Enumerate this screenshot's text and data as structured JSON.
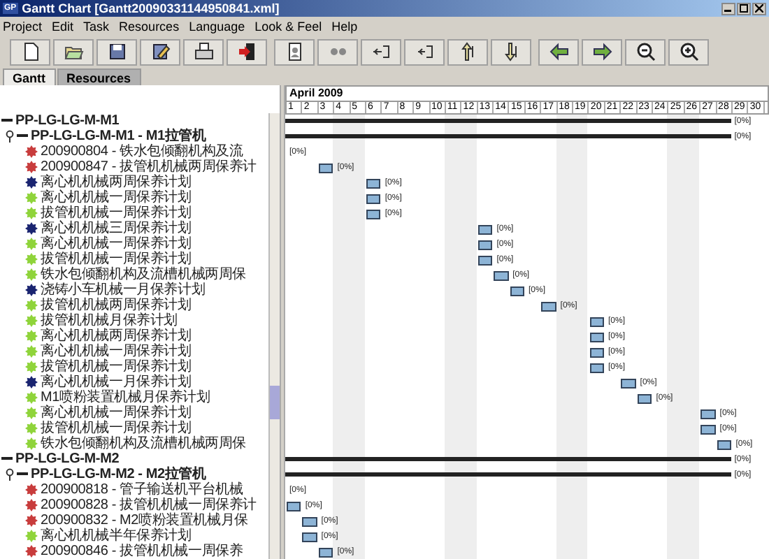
{
  "window": {
    "icon": "GP",
    "title": "Gantt Chart [Gantt20090331144950841.xml]"
  },
  "menu": [
    "Project",
    "Edit",
    "Task",
    "Resources",
    "Language",
    "Look & Feel",
    "Help"
  ],
  "tabs": [
    {
      "label": "Gantt",
      "selected": true
    },
    {
      "label": "Resources",
      "selected": false
    }
  ],
  "timeline": {
    "month": "April  2009",
    "days": [
      {
        "label": "1",
        "weekend": false
      },
      {
        "label": "2",
        "weekend": false
      },
      {
        "label": "3",
        "weekend": false
      },
      {
        "label": "4",
        "weekend": true
      },
      {
        "label": "5",
        "weekend": true
      },
      {
        "label": "6",
        "weekend": false
      },
      {
        "label": "7",
        "weekend": false
      },
      {
        "label": "8",
        "weekend": false
      },
      {
        "label": "9",
        "weekend": false
      },
      {
        "label": "10",
        "weekend": false
      },
      {
        "label": "11",
        "weekend": true
      },
      {
        "label": "12",
        "weekend": true
      },
      {
        "label": "13",
        "weekend": false
      },
      {
        "label": "14",
        "weekend": false
      },
      {
        "label": "15",
        "weekend": false
      },
      {
        "label": "16",
        "weekend": false
      },
      {
        "label": "17",
        "weekend": false
      },
      {
        "label": "18",
        "weekend": true
      },
      {
        "label": "19",
        "weekend": true
      },
      {
        "label": "20",
        "weekend": false
      },
      {
        "label": "21",
        "weekend": false
      },
      {
        "label": "22",
        "weekend": false
      },
      {
        "label": "23",
        "weekend": false
      },
      {
        "label": "24",
        "weekend": false
      },
      {
        "label": "25",
        "weekend": true
      },
      {
        "label": "26",
        "weekend": true
      },
      {
        "label": "27",
        "weekend": false
      },
      {
        "label": "28",
        "weekend": false
      },
      {
        "label": "29",
        "weekend": false
      },
      {
        "label": "30",
        "weekend": false
      }
    ]
  },
  "tasks": [
    {
      "name": "PP-LG-LG-M-M1",
      "bar": {
        "kind": "summary",
        "label": "[0%]"
      },
      "children": [
        {
          "name": "PP-LG-LG-M-M1 - M1拉管机",
          "expanded": true,
          "bar": {
            "kind": "summary",
            "label": "[0%]"
          },
          "children": [
            {
              "name": "200900804 - 铁水包倾翻机构及流",
              "color": "#c83c3c",
              "bar": {
                "kind": "milestone",
                "label": "[0%]"
              }
            },
            {
              "name": "200900847 - 拔管机机械两周保养计",
              "color": "#c83c3c",
              "bar": {
                "kind": "task",
                "label": "[0%]"
              }
            },
            {
              "name": "离心机机械两周保养计划",
              "color": "#1a2470",
              "bar": {
                "kind": "task",
                "label": "[0%]"
              }
            },
            {
              "name": "离心机机械一周保养计划",
              "color": "#8fd43a",
              "bar": {
                "kind": "task",
                "label": "[0%]"
              }
            },
            {
              "name": "拔管机机械一周保养计划",
              "color": "#8fd43a",
              "bar": {
                "kind": "task",
                "label": "[0%]"
              }
            },
            {
              "name": "离心机机械三周保养计划",
              "color": "#1a2470",
              "bar": {
                "kind": "task",
                "label": "[0%]"
              }
            },
            {
              "name": "离心机机械一周保养计划",
              "color": "#8fd43a",
              "bar": {
                "kind": "task",
                "label": "[0%]"
              }
            },
            {
              "name": "拔管机机械一周保养计划",
              "color": "#8fd43a",
              "bar": {
                "kind": "task",
                "label": "[0%]"
              }
            },
            {
              "name": "铁水包倾翻机构及流槽机械两周保",
              "color": "#8fd43a",
              "bar": {
                "kind": "task",
                "label": "[0%]"
              }
            },
            {
              "name": "浇铸小车机械一月保养计划",
              "color": "#1a2470",
              "bar": {
                "kind": "task",
                "label": "[0%]"
              }
            },
            {
              "name": "拔管机机械两周保养计划",
              "color": "#8fd43a",
              "bar": {
                "kind": "task",
                "label": "[0%]"
              }
            },
            {
              "name": "拔管机机械月保养计划",
              "color": "#8fd43a",
              "bar": {
                "kind": "task",
                "label": "[0%]"
              }
            },
            {
              "name": "离心机机械两周保养计划",
              "color": "#8fd43a",
              "bar": {
                "kind": "task",
                "label": "[0%]"
              }
            },
            {
              "name": "离心机机械一周保养计划",
              "color": "#8fd43a",
              "bar": {
                "kind": "task",
                "label": "[0%]"
              }
            },
            {
              "name": "拔管机机械一周保养计划",
              "color": "#8fd43a",
              "bar": {
                "kind": "task",
                "label": "[0%]"
              }
            },
            {
              "name": "离心机机械一月保养计划",
              "color": "#1a2470",
              "bar": {
                "kind": "task",
                "label": "[0%]"
              }
            },
            {
              "name": "M1喷粉装置机械月保养计划",
              "color": "#8fd43a",
              "bar": {
                "kind": "task",
                "label": "[0%]"
              }
            },
            {
              "name": "离心机机械一周保养计划",
              "color": "#8fd43a",
              "bar": {
                "kind": "task",
                "label": "[0%]"
              }
            },
            {
              "name": "拔管机机械一周保养计划",
              "color": "#8fd43a",
              "bar": {
                "kind": "task",
                "label": "[0%]"
              }
            },
            {
              "name": "铁水包倾翻机构及流槽机械两周保",
              "color": "#8fd43a",
              "bar": {
                "kind": "task",
                "label": "[0%]"
              }
            }
          ]
        }
      ]
    },
    {
      "name": "PP-LG-LG-M-M2",
      "bar": {
        "kind": "summary",
        "label": "[0%]"
      },
      "children": [
        {
          "name": "PP-LG-LG-M-M2 - M2拉管机",
          "expanded": true,
          "bar": {
            "kind": "summary",
            "label": "[0%]"
          },
          "children": [
            {
              "name": "200900818 - 管子输送机平台机械",
              "color": "#c83c3c",
              "bar": {
                "kind": "milestone",
                "label": "[0%]"
              }
            },
            {
              "name": "200900828 - 拔管机机械一周保养计",
              "color": "#c83c3c",
              "bar": {
                "kind": "task",
                "label": "[0%]"
              }
            },
            {
              "name": "200900832 - M2喷粉装置机械月保",
              "color": "#c83c3c",
              "bar": {
                "kind": "task",
                "label": "[0%]"
              }
            },
            {
              "name": "离心机机械半年保养计划",
              "color": "#8fd43a",
              "bar": {
                "kind": "task",
                "label": "[0%]"
              }
            },
            {
              "name": "200900846 - 拔管机机械一周保养",
              "color": "#c83c3c",
              "bar": {
                "kind": "task",
                "label": "[0%]"
              }
            }
          ]
        }
      ]
    }
  ]
}
